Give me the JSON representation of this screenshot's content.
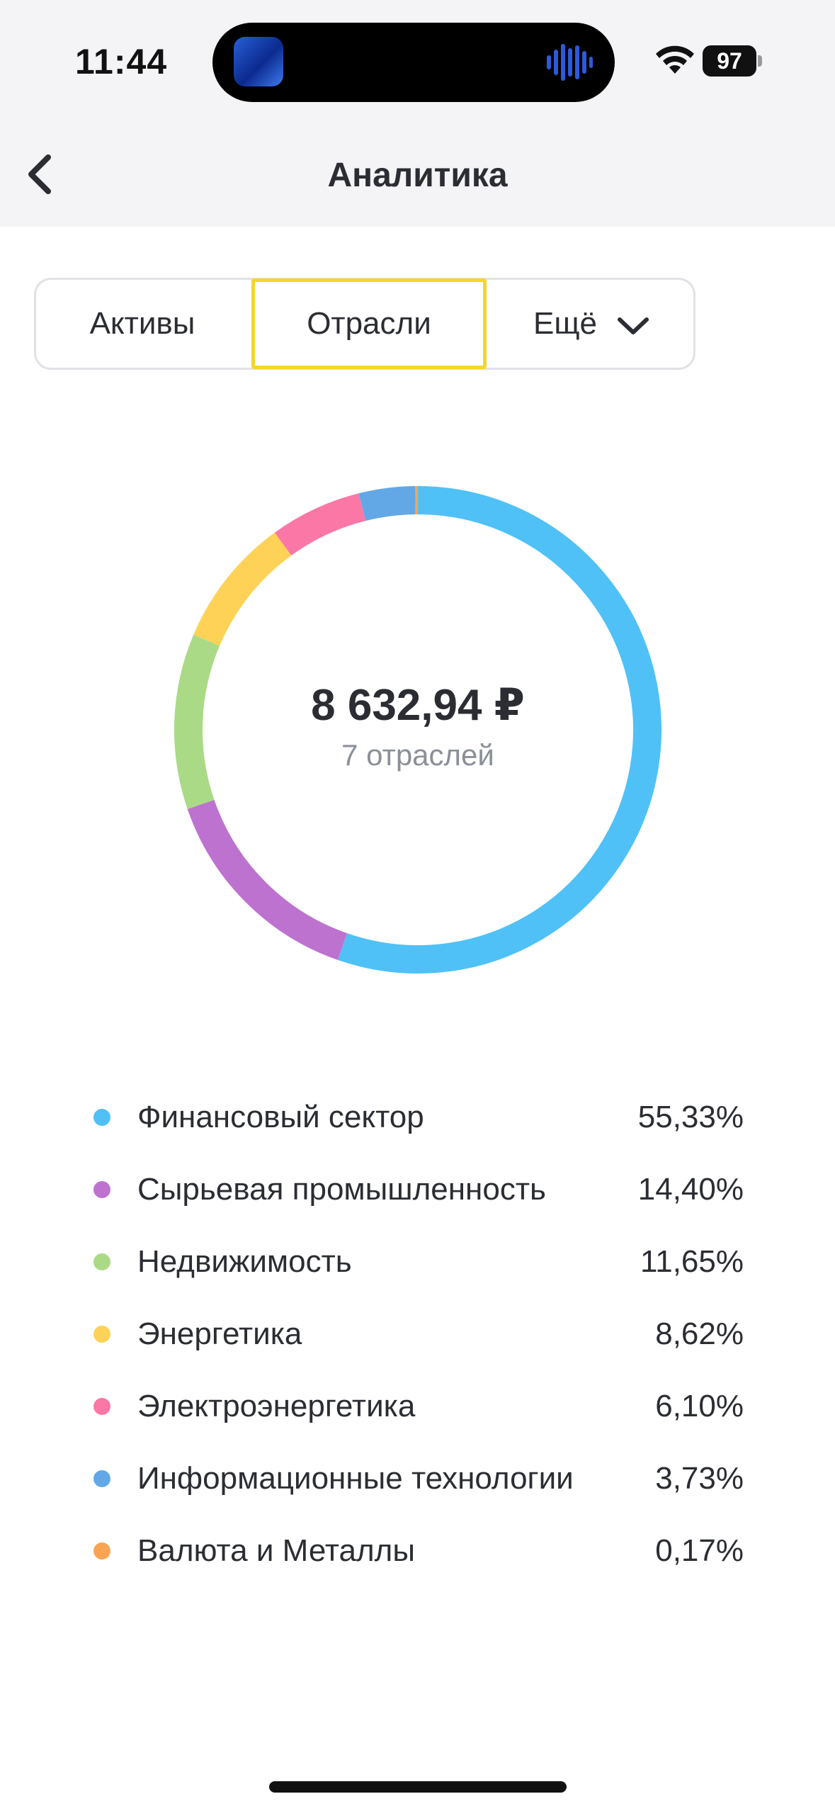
{
  "status_bar": {
    "time": "11:44",
    "battery": "97",
    "icons": [
      "wifi-icon",
      "battery-icon"
    ]
  },
  "header": {
    "title": "Аналитика",
    "back_icon": "chevron-left-icon"
  },
  "tabs": [
    {
      "label": "Активы",
      "active": false
    },
    {
      "label": "Отрасли",
      "active": true
    },
    {
      "label": "Ещё",
      "active": false,
      "icon": "chevron-down-icon"
    }
  ],
  "summary": {
    "amount": "8 632,94 ₽",
    "subtitle": "7 отраслей"
  },
  "legend": [
    {
      "label": "Финансовый сектор",
      "percent": "55,33%",
      "color": "#4fc1f6"
    },
    {
      "label": "Сырьевая промышленность",
      "percent": "14,40%",
      "color": "#bd72cf"
    },
    {
      "label": "Недвижимость",
      "percent": "11,65%",
      "color": "#abda86"
    },
    {
      "label": "Энергетика",
      "percent": "8,62%",
      "color": "#fdd256"
    },
    {
      "label": "Электроэнергетика",
      "percent": "6,10%",
      "color": "#fb78a6"
    },
    {
      "label": "Информационные технологии",
      "percent": "3,73%",
      "color": "#62a8e6"
    },
    {
      "label": "Валюта и Металлы",
      "percent": "0,17%",
      "color": "#f7a554"
    }
  ],
  "chart_data": {
    "type": "pie",
    "categories": [
      "Финансовый сектор",
      "Сырьевая промышленность",
      "Недвижимость",
      "Энергетика",
      "Электроэнергетика",
      "Информационные технологии",
      "Валюта и Металлы"
    ],
    "values": [
      55.33,
      14.4,
      11.65,
      8.62,
      6.1,
      3.73,
      0.17
    ],
    "colors": [
      "#4fc1f6",
      "#bd72cf",
      "#abda86",
      "#fdd256",
      "#fb78a6",
      "#62a8e6",
      "#f7a554"
    ],
    "donut": true,
    "title": ""
  }
}
